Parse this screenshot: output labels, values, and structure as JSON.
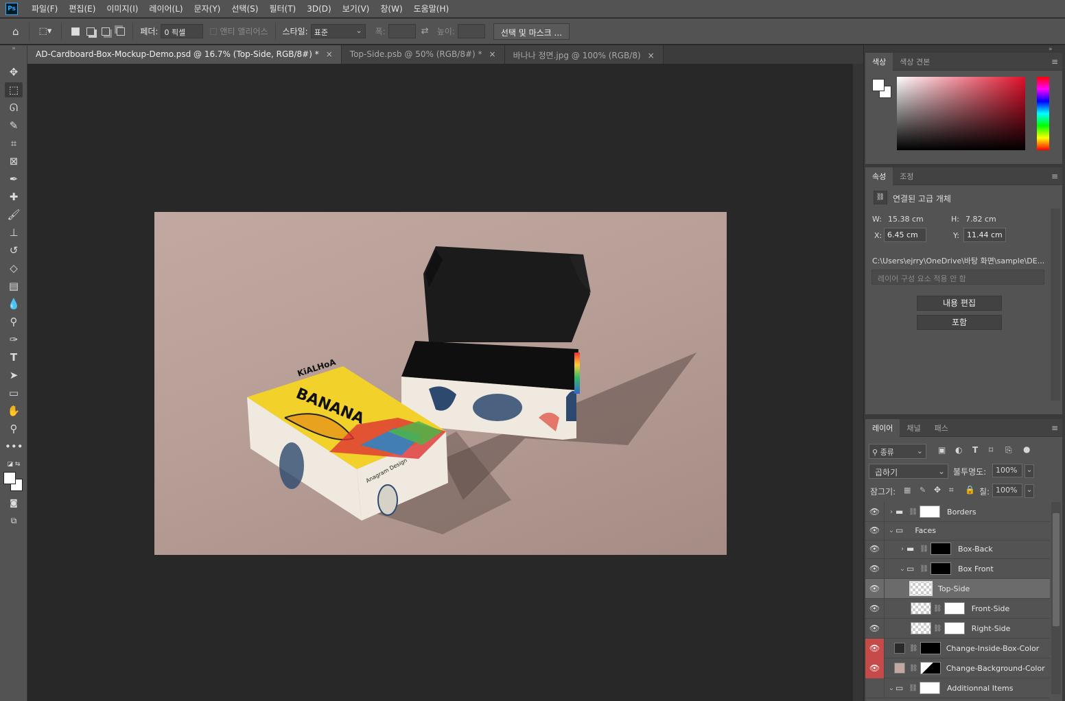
{
  "app": {
    "logo": "Ps"
  },
  "menu": [
    "파일(F)",
    "편집(E)",
    "이미지(I)",
    "레이어(L)",
    "문자(Y)",
    "선택(S)",
    "필터(T)",
    "3D(D)",
    "보기(V)",
    "창(W)",
    "도움말(H)"
  ],
  "options": {
    "feather_label": "페더:",
    "feather_value": "0 픽셀",
    "antialias_label": "앤티 앨리어스",
    "style_label": "스타일:",
    "style_value": "표준",
    "width_label": "폭:",
    "height_label": "높이:",
    "select_mask_button": "선택 및 마스크 ..."
  },
  "tabs": [
    {
      "label": "AD-Cardboard-Box-Mockup-Demo.psd @ 16.7% (Top-Side, RGB/8#) *",
      "close": "×"
    },
    {
      "label": "Top-Side.psb @ 50% (RGB/8#) *",
      "close": "×"
    },
    {
      "label": "바나나 정면.jpg @ 100% (RGB/8)",
      "close": "×"
    }
  ],
  "color_panel": {
    "tab_color": "색상",
    "tab_swatches": "색상 견본"
  },
  "properties_panel": {
    "tab_properties": "속성",
    "tab_adjust": "조정",
    "object_type": "연결된 고급 개체",
    "w_label": "W:",
    "w_value": "15.38 cm",
    "h_label": "H:",
    "h_value": "7.82 cm",
    "x_label": "X:",
    "x_value": "6.45 cm",
    "y_label": "Y:",
    "y_value": "11.44 cm",
    "path": "C:\\Users\\ejrry\\OneDrive\\바탕 화면\\sample\\DE...",
    "comp_placeholder": "레이어 구성 요소 적용 안 함",
    "edit_contents_button": "내용 편집",
    "embed_button": "포함"
  },
  "layers_panel": {
    "tab_layers": "레이어",
    "tab_channels": "채널",
    "tab_paths": "패스",
    "filter_kind": "종류",
    "blend_mode": "곱하기",
    "opacity_label": "불투명도:",
    "opacity_value": "100%",
    "lock_label": "잠그기:",
    "fill_label": "칠:",
    "fill_value": "100%",
    "layers": [
      {
        "name": "Borders"
      },
      {
        "name": "Faces"
      },
      {
        "name": "Box-Back"
      },
      {
        "name": "Box Front"
      },
      {
        "name": "Top-Side"
      },
      {
        "name": "Front-Side"
      },
      {
        "name": "Right-Side"
      },
      {
        "name": "Change-Inside-Box-Color"
      },
      {
        "name": "Change-Background-Color"
      },
      {
        "name": "Additionnal Items"
      }
    ]
  },
  "mockup": {
    "box_text_brand": "KiALHoA",
    "box_text_banana": "BANANA",
    "box_text_design": "Anagram Design"
  },
  "colors": {
    "ui_bg": "#535353",
    "canvas_bg": "#282828",
    "background_swatch": "#c1a9a2",
    "inside_swatch": "#2a2a2a",
    "visibility_highlight": "#c54a4a",
    "accent": "#31a8ff"
  }
}
